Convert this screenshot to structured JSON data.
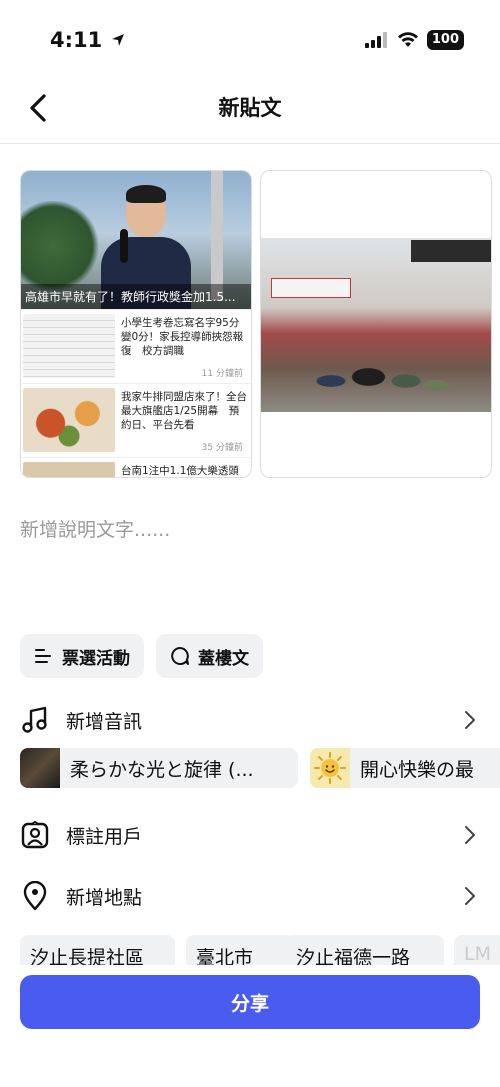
{
  "status": {
    "time": "4:11",
    "battery": "100"
  },
  "header": {
    "title": "新貼文"
  },
  "media": {
    "card1": {
      "hero_caption": "高雄市早就有了！教師行政獎金加1.5...",
      "items": [
        {
          "title": "小學生考卷忘寫名字95分變0分！家長控導師挾怨報復　校方調職",
          "time": "11 分鐘前"
        },
        {
          "title": "我家牛排同盟店來了！全台最大旗艦店1/25開幕　預約日、平台先看",
          "time": "35 分鐘前"
        },
        {
          "title": "台南1注中1.1億大樂透頭",
          "time": ""
        }
      ]
    }
  },
  "caption": {
    "placeholder": "新增說明文字......"
  },
  "actions": {
    "poll_label": "票選活動",
    "thread_label": "蓋樓文"
  },
  "music": {
    "label": "新增音訊",
    "suggestions": [
      {
        "title": "柔らかな光と旋律 (...",
        "icon": "piano-thumbnail"
      },
      {
        "title": "開心快樂の最",
        "icon": "sun-emoji"
      }
    ]
  },
  "tag_users": {
    "label": "標註用戶"
  },
  "location": {
    "label": "新增地點",
    "suggestions": [
      "汐止長提社區",
      "臺北市",
      "汐止福德一路",
      "LM"
    ]
  },
  "share": {
    "label": "分享",
    "color": "#4a5cf0"
  }
}
